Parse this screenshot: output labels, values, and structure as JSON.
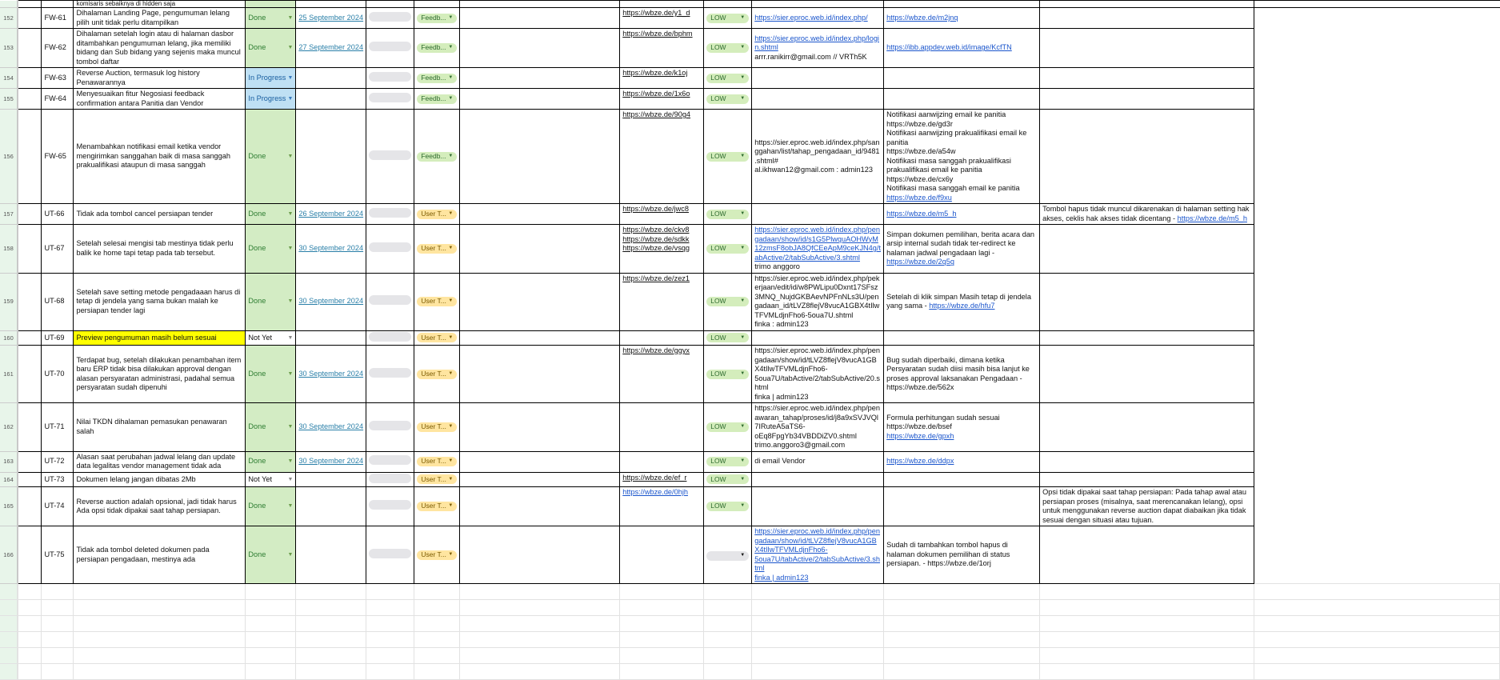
{
  "top_partial": "komisaris sebaiknya di hidden saja",
  "rows": [
    {
      "n": "152",
      "id": "FW-61",
      "desc": "Dihalaman Landing Page, pengumuman lelang pilih unit tidak perlu ditampilkan",
      "status": "Done",
      "date": "25 September 2024",
      "type": "Feedb...",
      "links": [
        "https://wbze.de/y1_d"
      ],
      "priority": "LOW",
      "url": [
        {
          "t": "https://sier.eproc.web.id/index.php/",
          "a": 1
        }
      ],
      "notes": [
        {
          "t": "https://wbze.de/m2jnq",
          "a": 1
        }
      ],
      "extra": []
    },
    {
      "n": "153",
      "id": "FW-62",
      "desc": "Dihalaman setelah login atau di halaman dasbor ditambahkan pengumuman lelang, jika memiliki bidang dan Sub bidang yang sejenis maka muncul tombol daftar",
      "status": "Done",
      "date": "27 September 2024",
      "type": "Feedb...",
      "links": [
        "https://wbze.de/bphm"
      ],
      "priority": "LOW",
      "url": [
        {
          "t": "https://sier.eproc.web.id/index.php/login.shtml",
          "a": 1
        },
        {
          "t": " "
        },
        {
          "t": "arrr.ranikirr@gmail.com // VRTh5K"
        }
      ],
      "notes": [
        {
          "t": "https://ibb.appdev.web.id/image/KcfTN",
          "a": 1
        }
      ],
      "extra": []
    },
    {
      "n": "154",
      "id": "FW-63",
      "desc": "Reverse Auction, termasuk log history Penawarannya",
      "status": "In Progress",
      "date": "",
      "type": "Feedb...",
      "links": [
        "https://wbze.de/k1oj"
      ],
      "priority": "LOW",
      "url": [],
      "notes": [],
      "extra": []
    },
    {
      "n": "155",
      "id": "FW-64",
      "desc": "Menyesuaikan fitur Negosiasi feedback confirmation antara Panitia dan Vendor",
      "status": "In Progress",
      "date": "",
      "type": "Feedb...",
      "links": [
        "https://wbze.de/1x6o"
      ],
      "priority": "LOW",
      "url": [],
      "notes": [],
      "extra": []
    },
    {
      "n": "156",
      "id": "FW-65",
      "desc": "Menambahkan notifikasi email ketika vendor mengirimkan sanggahan baik di masa sanggah prakualifikasi ataupun di masa sanggah",
      "status": "Done",
      "date": "",
      "type": "Feedb...",
      "links": [
        "https://wbze.de/90g4"
      ],
      "priority": "LOW",
      "url": [
        {
          "t": "https://sier.eproc.web.id/index.php/sanggahan/list/tahap_pengadaan_id/9481.shtml#"
        },
        {
          "t": "al.ikhwan12@gmail.com : admin123"
        }
      ],
      "notes": [
        {
          "t": "Notifikasi aanwijzing email ke panitia"
        },
        {
          "t": "https://wbze.de/gd3r"
        },
        {
          "t": "Notifikasi aanwijzing prakualifikasi email ke panitia"
        },
        {
          "t": "https://wbze.de/a54w"
        },
        {
          "t": "Notifikasi masa sanggah prakualifikasi prakualifikasi email ke panitia"
        },
        {
          "t": "https://wbze.de/cx6y"
        },
        {
          "t": "Notifikasi masa sanggah email ke panitia"
        },
        {
          "t": "https://wbze.de/f9xu",
          "a": 1
        }
      ],
      "extra": []
    },
    {
      "n": "157",
      "id": "UT-66",
      "desc": "Tidak ada tombol cancel persiapan tender",
      "status": "Done",
      "date": "26 September 2024",
      "type": "User T...",
      "links": [
        "https://wbze.de/jwc8"
      ],
      "priority": "LOW",
      "url": [],
      "notes": [
        {
          "t": "https://wbze.de/m5_h",
          "a": 1
        }
      ],
      "extra": [
        {
          "t": "Tombol hapus tidak muncul dikarenakan di halaman setting hak akses, ceklis hak akses tidak dicentang - ",
          "i": 1
        },
        {
          "t": "https://wbze.de/m5_h",
          "a": 1,
          "i": 1
        }
      ]
    },
    {
      "n": "158",
      "id": "UT-67",
      "desc": "Setelah selesai mengisi tab mestinya tidak perlu balik ke home tapi tetap pada tab tersebut.",
      "status": "Done",
      "date": "30 September 2024",
      "type": "User T...",
      "links": [
        "https://wbze.de/ckv8",
        "https://wbze.de/sdkk",
        "https://wbze.de/vsqg"
      ],
      "priority": "LOW",
      "url": [
        {
          "t": "https://sier.eproc.web.id/index.php/pengadaan/show/id/s1G5PlwquAOHWyM12zmsF8obJA8QfCEeApM9ceKJN4g/tabActive/2/tabSubActive/3.shtml",
          "a": 1
        },
        {
          "t": "trimo anggoro"
        }
      ],
      "notes": [
        {
          "t": "Simpan dokumen pemilihan, berita acara dan arsip internal sudah tidak ter-redirect ke halaman jadwal pengadaan lagi - ",
          "i": 1
        },
        {
          "t": "https://wbze.de/2q5g",
          "a": 1,
          "i": 1
        }
      ],
      "extra": []
    },
    {
      "n": "159",
      "id": "UT-68",
      "desc": "Setelah save setting metode pengadaaan harus di tetap di jendela yang sama bukan malah ke persiapan tender lagi",
      "status": "Done",
      "date": "30 September 2024",
      "type": "User T...",
      "links": [
        "https://wbze.de/zez1"
      ],
      "priority": "LOW",
      "url": [
        {
          "t": "https://sier.eproc.web.id/index.php/pekerjaan/edit/id/w8PWLipu0Dxnt17SFsz3MNQ_NujdGKBAevNPFnNLs3U/pengadaan_id/tLVZ8flejV8vucA1GBX4tIlwTFVMLdjnFho6-5oua7U.shtml"
        },
        {
          "t": "finka : admin123"
        }
      ],
      "notes": [
        {
          "t": "Setelah di klik simpan Masih tetap di jendela yang sama - ",
          "i": 1
        },
        {
          "t": "https://wbze.de/hfu7",
          "a": 1,
          "i": 1
        }
      ],
      "extra": []
    },
    {
      "n": "160",
      "id": "UT-69",
      "desc": "Preview pengumuman masih belum sesuai",
      "hl": true,
      "status": "Not Yet",
      "date": "",
      "type": "User T...",
      "links": [],
      "priority": "LOW",
      "url": [],
      "notes": [],
      "extra": []
    },
    {
      "n": "161",
      "id": "UT-70",
      "desc": "Terdapat bug, setelah dilakukan penambahan item baru ERP tidak bisa dilakukan approval dengan alasan persyaratan administrasi, padahal semua persyaratan sudah dipenuhi",
      "status": "Done",
      "date": "30 September 2024",
      "type": "User T...",
      "links": [
        "https://wbze.de/ggyx"
      ],
      "priority": "LOW",
      "url": [
        {
          "t": "https://sier.eproc.web.id/index.php/pengadaan/show/id/tLVZ8flejV8vucA1GBX4tIlwTFVMLdjnFho6-5oua7U/tabActive/2/tabSubActive/20.shtml"
        },
        {
          "t": "finka | admin123"
        }
      ],
      "notes": [
        {
          "t": "Bug sudah diperbaiki, dimana ketika Persyaratan sudah diisi masih bisa lanjut ke proses approval laksanakan Pengadaan - https://wbze.de/562x"
        }
      ],
      "extra": []
    },
    {
      "n": "162",
      "id": "UT-71",
      "desc": "Nilai TKDN dihalaman pemasukan penawaran salah",
      "status": "Done",
      "date": "30 September 2024",
      "type": "User T...",
      "links": [],
      "priority": "LOW",
      "url": [
        {
          "t": "https://sier.eproc.web.id/index.php/penawaran_tahap/proses/id/j8a9xSVJVQl7IRuteA5aTS6-oEq8FpgYb34VBDDiZV0.shtml"
        },
        {
          "t": "trimo.anggoro3@gmail.com"
        }
      ],
      "notes": [
        {
          "t": "Formula perhitungan sudah sesuai"
        },
        {
          "t": "https://wbze.de/bsef"
        },
        {
          "t": "https://wbze.de/gpxh",
          "a": 1
        }
      ],
      "extra": []
    },
    {
      "n": "163",
      "id": "UT-72",
      "desc": "Alasan saat perubahan jadwal lelang dan update data legalitas vendor management tidak ada",
      "status": "Done",
      "date": "30 September 2024",
      "type": "User T...",
      "links": [],
      "priority": "LOW",
      "url": [
        {
          "t": "di email Vendor"
        }
      ],
      "notes": [
        {
          "t": "https://wbze.de/ddpx",
          "a": 1
        }
      ],
      "extra": []
    },
    {
      "n": "164",
      "id": "UT-73",
      "desc": "Dokumen lelang jangan dibatas 2Mb",
      "status": "Not Yet",
      "date": "",
      "type": "User T...",
      "links": [
        "https://wbze.de/ef_r"
      ],
      "priority": "LOW",
      "url": [],
      "notes": [],
      "extra": []
    },
    {
      "n": "165",
      "id": "UT-74",
      "desc": "Reverse auction adalah opsional, jadi tidak harus Ada opsi tidak dipakai saat tahap persiapan.",
      "status": "Done",
      "date": "",
      "type": "User T...",
      "links": [
        "https://wbze.de/0hjh"
      ],
      "linkBlue": true,
      "priority": "LOW",
      "url": [],
      "notes": [],
      "extra": [
        {
          "t": "Opsi tidak dipakai saat tahap persiapan: Pada tahap awal atau persiapan proses (misalnya, saat merencanakan lelang), opsi untuk menggunakan reverse auction dapat diabaikan jika tidak sesuai dengan situasi atau tujuan."
        }
      ]
    },
    {
      "n": "166",
      "id": "UT-75",
      "desc": "Tidak ada tombol deleted dokumen pada persiapan pengadaan, mestinya ada",
      "status": "Done",
      "date": "",
      "type": "User T...",
      "links": [],
      "priority": "",
      "url": [
        {
          "t": "https://sier.eproc.web.id/index.php/pengadaan/show/id/tLVZ8flejV8vucA1GBX4tIlwTFVMLdjnFho6-5oua7U/tabActive/2/tabSubActive/3.shtml",
          "a": 1
        },
        {
          "t": "finka | admin123",
          "a": 1
        }
      ],
      "notes": [
        {
          "t": "Sudah di tambahkan tombol hapus di halaman dokumen pemilihan di status persiapan. - https://wbze.de/1orj"
        }
      ],
      "extra": []
    }
  ],
  "colors": {
    "done": "#d3ecc4",
    "in_progress": "#bfe0f4",
    "highlight": "#ffff00",
    "feedback_chip": "#d4edbc",
    "user_chip": "#ffe5a0"
  }
}
